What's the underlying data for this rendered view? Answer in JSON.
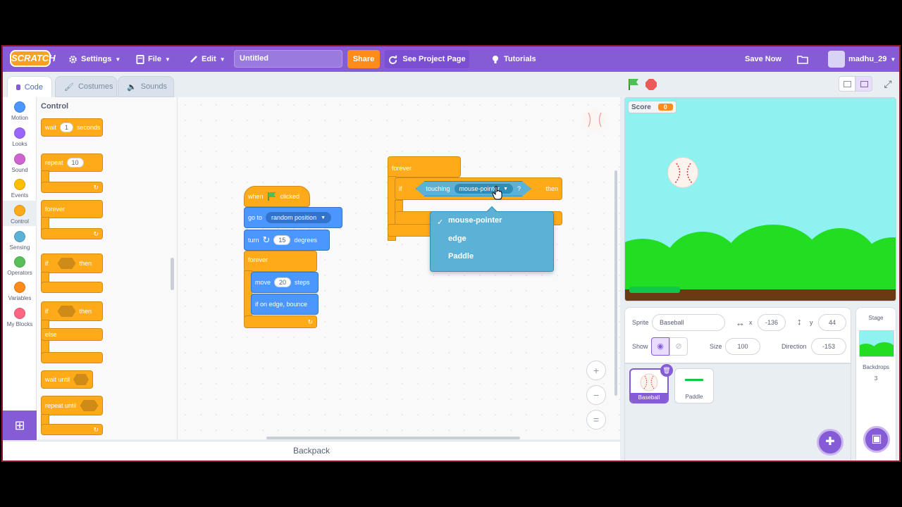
{
  "menubar": {
    "logo": "SCRATCH",
    "settings": "Settings",
    "file": "File",
    "edit": "Edit",
    "project_title": "Untitled",
    "share": "Share",
    "see_project": "See Project Page",
    "tutorials": "Tutorials",
    "save_now": "Save Now",
    "username": "madhu_29"
  },
  "tabs": {
    "code": "Code",
    "costumes": "Costumes",
    "sounds": "Sounds"
  },
  "categories": [
    {
      "label": "Motion",
      "color": "#4c97ff"
    },
    {
      "label": "Looks",
      "color": "#9966ff"
    },
    {
      "label": "Sound",
      "color": "#cf63cf"
    },
    {
      "label": "Events",
      "color": "#ffbf00"
    },
    {
      "label": "Control",
      "color": "#ffab19"
    },
    {
      "label": "Sensing",
      "color": "#5cb1d6"
    },
    {
      "label": "Operators",
      "color": "#59c059"
    },
    {
      "label": "Variables",
      "color": "#ff8c1a"
    },
    {
      "label": "My Blocks",
      "color": "#ff6680"
    }
  ],
  "palette": {
    "title": "Control",
    "wait": "wait",
    "wait_value": "1",
    "seconds": "seconds",
    "repeat": "repeat",
    "repeat_value": "10",
    "forever": "forever",
    "if1": "if",
    "then1": "then",
    "if2": "if",
    "then2": "then",
    "else": "else",
    "wait_until": "wait until",
    "repeat_until": "repeat until"
  },
  "script1": {
    "when": "when",
    "clicked": "clicked",
    "go_to": "go to",
    "go_to_target": "random position",
    "turn": "turn",
    "turn_value": "15",
    "degrees": "degrees",
    "forever": "forever",
    "move": "move",
    "move_value": "20",
    "steps": "steps",
    "bounce": "if on edge, bounce"
  },
  "script2": {
    "forever": "forever",
    "if": "if",
    "touching": "touching",
    "touching_target": "mouse-pointer",
    "question": "?",
    "then": "then"
  },
  "dropdown": {
    "options": [
      "mouse-pointer",
      "edge",
      "Paddle"
    ],
    "selected": "mouse-pointer",
    "check": "✓"
  },
  "backpack": "Backpack",
  "stage": {
    "score_label": "Score",
    "score_value": "0"
  },
  "sprite_info": {
    "sprite_label": "Sprite",
    "sprite_name": "Baseball",
    "x_label": "x",
    "x_value": "-136",
    "y_label": "y",
    "y_value": "44",
    "show_label": "Show",
    "size_label": "Size",
    "size_value": "100",
    "direction_label": "Direction",
    "direction_value": "-153"
  },
  "sprites": [
    {
      "name": "Baseball"
    },
    {
      "name": "Paddle"
    }
  ],
  "stage_panel": {
    "title": "Stage",
    "backdrops_label": "Backdrops",
    "backdrops_count": "3"
  },
  "colors": {
    "menubar": "#855cd6",
    "control": "#ffab19",
    "motion": "#4c97ff",
    "sensing": "#5cb1d6",
    "share": "#ff8c1a"
  }
}
